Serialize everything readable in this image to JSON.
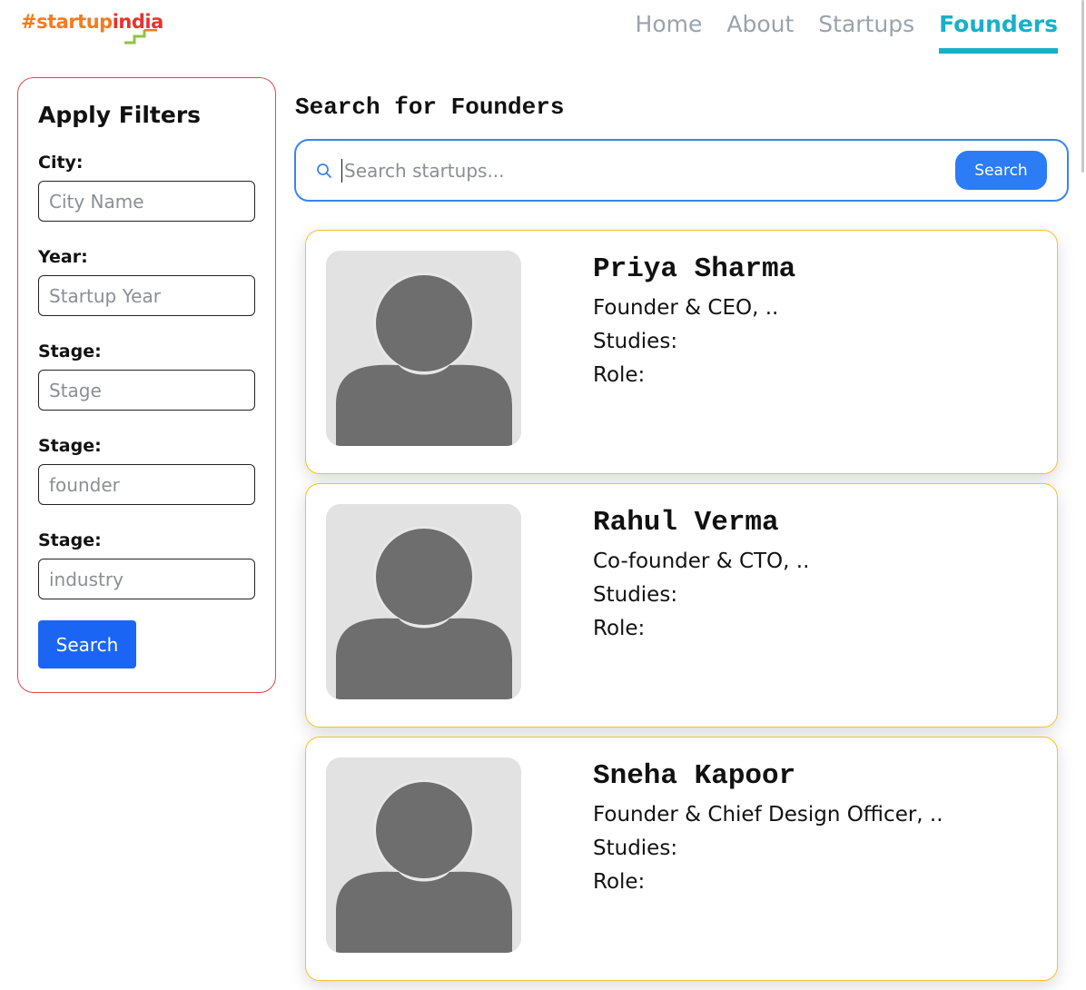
{
  "brand": {
    "hash": "#",
    "part1": "startup",
    "part2": "india",
    "logo_icon": "steps-logo-mark"
  },
  "nav": {
    "items": [
      {
        "label": "Home",
        "active": false
      },
      {
        "label": "About",
        "active": false
      },
      {
        "label": "Startups",
        "active": false
      },
      {
        "label": "Founders",
        "active": true
      }
    ]
  },
  "filters": {
    "title": "Apply Filters",
    "fields": [
      {
        "label": "City:",
        "placeholder": "City Name",
        "value": ""
      },
      {
        "label": "Year:",
        "placeholder": "Startup Year",
        "value": ""
      },
      {
        "label": "Stage:",
        "placeholder": "Stage",
        "value": ""
      },
      {
        "label": "Stage:",
        "placeholder": "founder",
        "value": ""
      },
      {
        "label": "Stage:",
        "placeholder": "industry",
        "value": ""
      }
    ],
    "search_label": "Search"
  },
  "main": {
    "title": "Search for Founders",
    "search": {
      "placeholder": "Search startups...",
      "value": "",
      "button_label": "Search",
      "icon": "search-icon"
    }
  },
  "founders": [
    {
      "name": "Priya Sharma",
      "position": "Founder & CEO, ..",
      "studies": "Studies:",
      "role": "Role:",
      "avatar_icon": "person-placeholder-icon"
    },
    {
      "name": "Rahul Verma",
      "position": "Co-founder & CTO, ..",
      "studies": "Studies:",
      "role": "Role:",
      "avatar_icon": "person-placeholder-icon"
    },
    {
      "name": "Sneha Kapoor",
      "position": "Founder & Chief Design Officer, ..",
      "studies": "Studies:",
      "role": "Role:",
      "avatar_icon": "person-placeholder-icon"
    }
  ],
  "colors": {
    "accent": "#17b0c9",
    "nav_inactive": "#9aa3ab",
    "filter_border": "#e8454a",
    "card_border": "#f2c230",
    "search_border": "#3b82f6",
    "primary_button": "#1b65f5",
    "brand_orange": "#f47a20",
    "brand_green": "#8cc63f"
  }
}
